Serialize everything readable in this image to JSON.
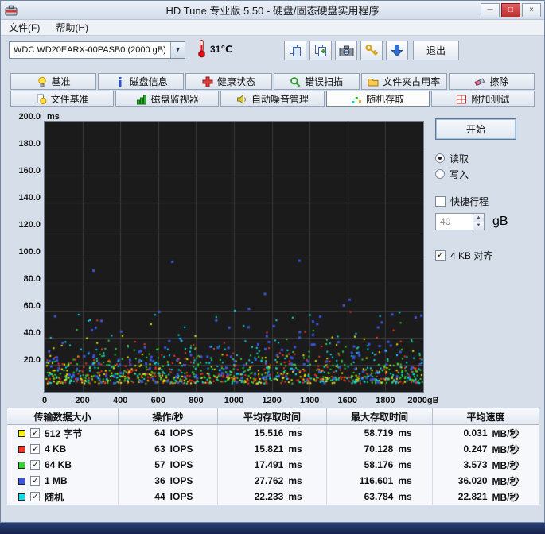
{
  "window": {
    "title": "HD Tune 专业版 5.50 - 硬盘/固态硬盘实用程序",
    "buttons": [
      {
        "id": "minimize",
        "glyph": "─"
      },
      {
        "id": "maximize",
        "glyph": "□"
      },
      {
        "id": "close",
        "glyph": "×"
      }
    ]
  },
  "menu": {
    "items": [
      {
        "id": "file",
        "label": "文件(F)"
      },
      {
        "id": "help",
        "label": "帮助(H)"
      }
    ]
  },
  "toolbar": {
    "drive_value": "WDC WD20EARX-00PASB0 (2000 gB)",
    "temperature_value": "31℃",
    "buttons": [
      {
        "id": "copy-info",
        "icon": "copy"
      },
      {
        "id": "copy-screenshot",
        "icon": "pages"
      },
      {
        "id": "save-screenshot",
        "icon": "camera"
      },
      {
        "id": "options",
        "icon": "keys"
      },
      {
        "id": "update-check",
        "icon": "down-arrow"
      }
    ],
    "exit_label": "退出"
  },
  "tabs": {
    "row1": [
      {
        "id": "benchmark",
        "label": "基准",
        "icon": "bulb",
        "active": false
      },
      {
        "id": "disk-info",
        "label": "磁盘信息",
        "icon": "info",
        "active": false
      },
      {
        "id": "health",
        "label": "健康状态",
        "icon": "health",
        "active": false
      },
      {
        "id": "error-scan",
        "label": "错误扫描",
        "icon": "scan",
        "active": false
      },
      {
        "id": "folder-usage",
        "label": "文件夹占用率",
        "icon": "folder",
        "active": false
      },
      {
        "id": "erase",
        "label": "擦除",
        "icon": "erase",
        "active": false
      }
    ],
    "row2": [
      {
        "id": "file-benchmark",
        "label": "文件基准",
        "icon": "file-benchmark",
        "active": false
      },
      {
        "id": "disk-monitor",
        "label": "磁盘监视器",
        "icon": "monitor",
        "active": false
      },
      {
        "id": "aam",
        "label": "自动噪音管理",
        "icon": "speaker",
        "active": false
      },
      {
        "id": "random-access",
        "label": "随机存取",
        "icon": "random",
        "active": true
      },
      {
        "id": "extra-tests",
        "label": "附加测试",
        "icon": "extra",
        "active": false
      }
    ]
  },
  "controls": {
    "start_label": "开始",
    "read_label": "读取",
    "read_selected": true,
    "write_label": "写入",
    "write_selected": false,
    "quick_label": "快捷行程",
    "quick_checked": false,
    "quick_value": "40",
    "quick_unit": "gB",
    "align_label": "4 KB 对齐",
    "align_checked": true
  },
  "icons": {
    "chevron_down": "▼",
    "spin_up": "▲",
    "spin_down": "▼"
  },
  "chart_data": {
    "type": "scatter",
    "title": "随机存取 access time scatter",
    "ylabel": "ms",
    "ylim": [
      0,
      200
    ],
    "xlim": [
      0,
      2000
    ],
    "grid": true,
    "background": "#1b1b1b",
    "grid_color": "#3a3a3a",
    "ytick_labels": [
      "200.0",
      "180.0",
      "160.0",
      "140.0",
      "120.0",
      "100.0",
      "80.0",
      "60.0",
      "40.0",
      "20.0"
    ],
    "xtick_labels": [
      "0",
      "200",
      "400",
      "600",
      "800",
      "1000",
      "1200",
      "1400",
      "1600",
      "1800",
      "2000gB"
    ],
    "series": [
      {
        "name": "512 字节",
        "color": "#f5f000",
        "avg_ms": 15.516,
        "max_ms": 58.719,
        "point_count": 260,
        "dot_size": 2
      },
      {
        "name": "4 KB",
        "color": "#ff3322",
        "avg_ms": 15.821,
        "max_ms": 70.128,
        "point_count": 260,
        "dot_size": 2
      },
      {
        "name": "64 KB",
        "color": "#2ed62e",
        "avg_ms": 17.491,
        "max_ms": 58.176,
        "point_count": 260,
        "dot_size": 2
      },
      {
        "name": "1 MB",
        "color": "#3d55e0",
        "avg_ms": 27.762,
        "max_ms": 116.601,
        "point_count": 160,
        "dot_size": 3
      },
      {
        "name": "随机",
        "color": "#00e0ee",
        "avg_ms": 22.233,
        "max_ms": 63.784,
        "point_count": 260,
        "dot_size": 2
      }
    ]
  },
  "table": {
    "headers": [
      "传输数据大小",
      "操作/秒",
      "平均存取时间",
      "最大存取时间",
      "平均速度"
    ],
    "rows": [
      {
        "label": "512 字节",
        "checked": true,
        "iops": "64",
        "iops_unit": "IOPS",
        "avg": "15.516",
        "avg_unit": "ms",
        "max": "58.719",
        "max_unit": "ms",
        "speed": "0.031",
        "speed_unit": "MB/秒"
      },
      {
        "label": "4 KB",
        "checked": true,
        "iops": "63",
        "iops_unit": "IOPS",
        "avg": "15.821",
        "avg_unit": "ms",
        "max": "70.128",
        "max_unit": "ms",
        "speed": "0.247",
        "speed_unit": "MB/秒"
      },
      {
        "label": "64 KB",
        "checked": true,
        "iops": "57",
        "iops_unit": "IOPS",
        "avg": "17.491",
        "avg_unit": "ms",
        "max": "58.176",
        "max_unit": "ms",
        "speed": "3.573",
        "speed_unit": "MB/秒"
      },
      {
        "label": "1 MB",
        "checked": true,
        "iops": "36",
        "iops_unit": "IOPS",
        "avg": "27.762",
        "avg_unit": "ms",
        "max": "116.601",
        "max_unit": "ms",
        "speed": "36.020",
        "speed_unit": "MB/秒"
      },
      {
        "label": "随机",
        "checked": true,
        "iops": "44",
        "iops_unit": "IOPS",
        "avg": "22.233",
        "avg_unit": "ms",
        "max": "63.784",
        "max_unit": "ms",
        "speed": "22.821",
        "speed_unit": "MB/秒"
      }
    ]
  }
}
